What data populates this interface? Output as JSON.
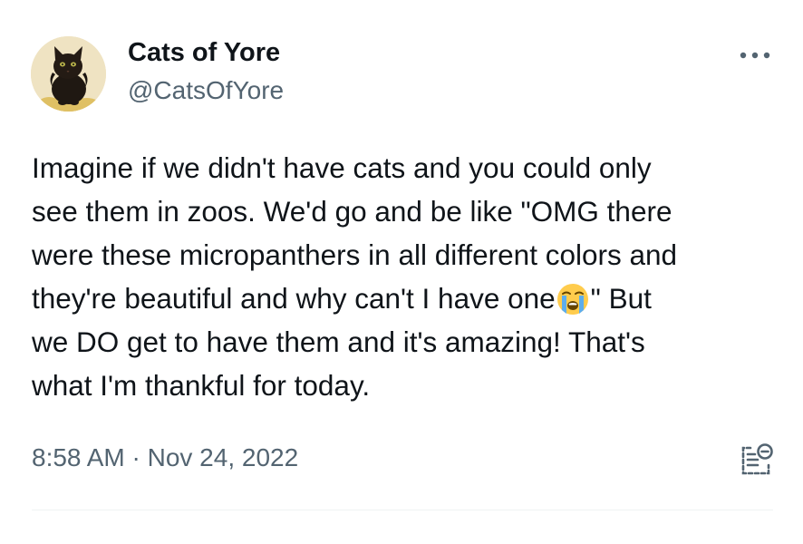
{
  "author": {
    "display_name": "Cats of Yore",
    "handle": "@CatsOfYore",
    "avatar_icon": "black-kitten-avatar"
  },
  "tweet": {
    "lines": [
      "Imagine if we didn't have cats and you could only",
      "see them in zoos. We'd go and be like \"OMG there",
      "were these micropanthers in all different colors and",
      "they're beautiful and why can't I have one",
      "\" But",
      "we DO get to have them and it's amazing! That's",
      "what I'm thankful for today."
    ],
    "emoji": "loudly-crying-face-emoji"
  },
  "meta": {
    "timestamp": "8:58 AM · Nov 24, 2022"
  },
  "icons": {
    "more": "more-options-icon",
    "views": "view-activity-icon"
  },
  "colors": {
    "text": "#0f1419",
    "secondary": "#536471",
    "divider": "#eff3f4"
  }
}
